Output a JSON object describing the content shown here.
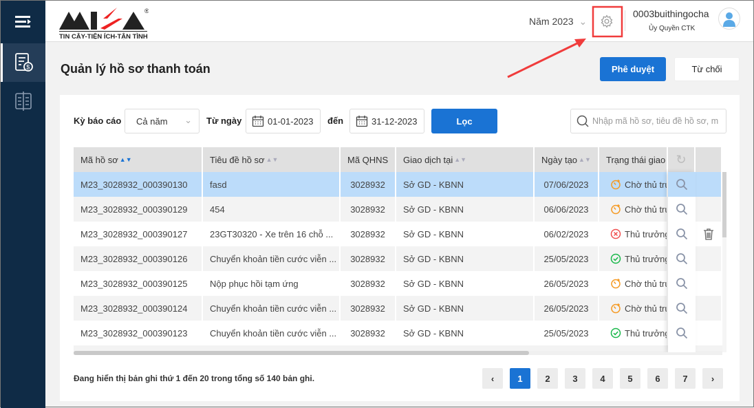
{
  "sidebar": {
    "items": [
      {
        "icon": "menu-icon"
      },
      {
        "icon": "payment-document-icon",
        "active": true
      },
      {
        "icon": "book-icon"
      }
    ]
  },
  "header": {
    "logo_text": "MISA",
    "logo_tagline": "TIN CẬY-TIỆN ÍCH-TẬN TÌNH",
    "year": "Năm 2023",
    "username": "0003buithingocha",
    "role": "Ủy Quyền CTK"
  },
  "page": {
    "title": "Quản lý hồ sơ thanh toán",
    "approve": "Phê duyệt",
    "reject": "Từ chối"
  },
  "filter": {
    "period_label": "Kỳ báo cáo",
    "period_value": "Cả năm",
    "from_label": "Từ ngày",
    "from_value": "01-01-2023",
    "to_label": "đến",
    "to_value": "31-12-2023",
    "filter_button": "Lọc",
    "search_placeholder": "Nhập mã hồ sơ, tiêu đề hồ sơ, m"
  },
  "table": {
    "columns": [
      "Mã hồ sơ",
      "Tiêu đề hồ sơ",
      "Mã QHNS",
      "Giao dịch tại",
      "Ngày tạo",
      "Trạng thái giao"
    ],
    "rows": [
      {
        "code": "M23_3028932_000390130",
        "title": "fasd",
        "qhns": "3028932",
        "place": "Sở GD - KBNN",
        "date": "07/06/2023",
        "status": "Chờ thủ trư",
        "state": "pending",
        "selected": true
      },
      {
        "code": "M23_3028932_000390129",
        "title": "454",
        "qhns": "3028932",
        "place": "Sở GD - KBNN",
        "date": "06/06/2023",
        "status": "Chờ thủ trư",
        "state": "pending"
      },
      {
        "code": "M23_3028932_000390127",
        "title": "23GT30320 - Xe trên 16 chỗ ...",
        "qhns": "3028932",
        "place": "Sở GD - KBNN",
        "date": "06/02/2023",
        "status": "Thủ trưởng",
        "state": "rejected",
        "deletable": true
      },
      {
        "code": "M23_3028932_000390126",
        "title": "Chuyển khoản tiền cước viễn ...",
        "qhns": "3028932",
        "place": "Sở GD - KBNN",
        "date": "25/05/2023",
        "status": "Thủ trưởng",
        "state": "approved"
      },
      {
        "code": "M23_3028932_000390125",
        "title": "Nộp phục hồi tạm ứng",
        "qhns": "3028932",
        "place": "Sở GD - KBNN",
        "date": "26/05/2023",
        "status": "Chờ thủ trư",
        "state": "pending"
      },
      {
        "code": "M23_3028932_000390124",
        "title": "Chuyển khoản tiền cước viễn ...",
        "qhns": "3028932",
        "place": "Sở GD - KBNN",
        "date": "26/05/2023",
        "status": "Chờ thủ trư",
        "state": "pending"
      },
      {
        "code": "M23_3028932_000390123",
        "title": "Chuyển khoản tiền cước viễn ...",
        "qhns": "3028932",
        "place": "Sở GD - KBNN",
        "date": "25/05/2023",
        "status": "Thủ trưởng",
        "state": "approved"
      }
    ]
  },
  "footer": {
    "summary": "Đang hiển thị bản ghi thứ 1 đến 20 trong tổng số 140 bản ghi.",
    "pages": [
      "1",
      "2",
      "3",
      "4",
      "5",
      "6",
      "7"
    ],
    "current_page": "1"
  },
  "colors": {
    "sidebar": "#0f2b46",
    "primary": "#1a73d4",
    "selected_row": "#bcdcfa",
    "pending": "#f59a23",
    "rejected": "#f05050",
    "approved": "#19b84a",
    "annotation": "#f03c3c"
  }
}
